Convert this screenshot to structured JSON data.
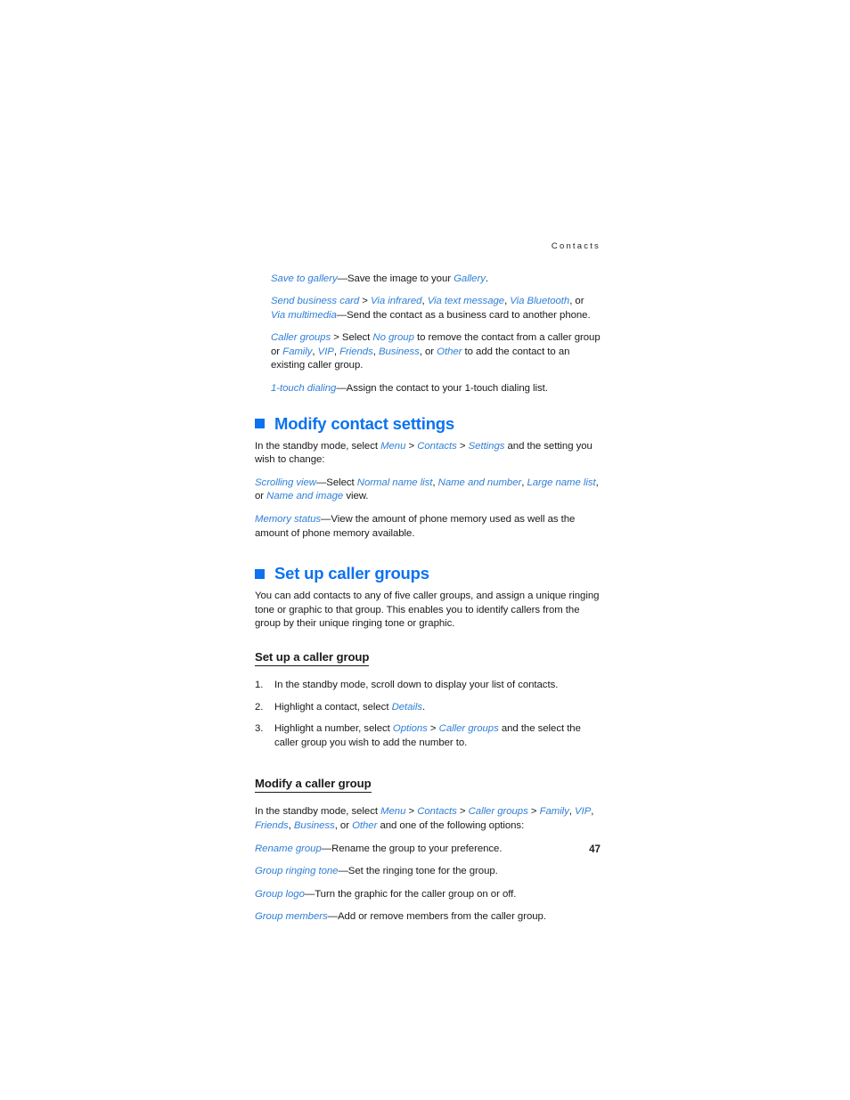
{
  "page": {
    "running_head": "Contacts",
    "page_number": "47",
    "accent_color": "#0c72ef",
    "link_color": "#2f7fd6",
    "text_color": "#1a1a1a"
  },
  "options_block": {
    "items": [
      {
        "id": "save-to-gallery",
        "segments": [
          {
            "t": "Save to gallery",
            "s": "link"
          },
          {
            "t": "—Save the image to your ",
            "s": "plain"
          },
          {
            "t": "Gallery",
            "s": "link"
          },
          {
            "t": ".",
            "s": "plain"
          }
        ]
      },
      {
        "id": "send-business-card",
        "segments": [
          {
            "t": "Send business card",
            "s": "link"
          },
          {
            "t": " > ",
            "s": "plain"
          },
          {
            "t": "Via infrared",
            "s": "link"
          },
          {
            "t": ", ",
            "s": "plain"
          },
          {
            "t": "Via text message",
            "s": "link"
          },
          {
            "t": ", ",
            "s": "plain"
          },
          {
            "t": "Via Bluetooth",
            "s": "link"
          },
          {
            "t": ", or ",
            "s": "plain"
          },
          {
            "t": "Via multimedia",
            "s": "link"
          },
          {
            "t": "—Send the contact as a business card to another phone.",
            "s": "plain"
          }
        ]
      },
      {
        "id": "caller-groups",
        "segments": [
          {
            "t": "Caller groups",
            "s": "link"
          },
          {
            "t": " > Select ",
            "s": "plain"
          },
          {
            "t": "No group",
            "s": "link"
          },
          {
            "t": " to remove the contact from a caller group or ",
            "s": "plain"
          },
          {
            "t": "Family",
            "s": "link"
          },
          {
            "t": ", ",
            "s": "plain"
          },
          {
            "t": "VIP",
            "s": "link"
          },
          {
            "t": ", ",
            "s": "plain"
          },
          {
            "t": "Friends",
            "s": "link"
          },
          {
            "t": ", ",
            "s": "plain"
          },
          {
            "t": "Business",
            "s": "link"
          },
          {
            "t": ", or ",
            "s": "plain"
          },
          {
            "t": "Other",
            "s": "link"
          },
          {
            "t": " to add the contact to an existing caller group.",
            "s": "plain"
          }
        ]
      },
      {
        "id": "one-touch-dialing",
        "segments": [
          {
            "t": "1-touch dialing",
            "s": "link"
          },
          {
            "t": "—Assign the contact to your 1-touch dialing list.",
            "s": "plain"
          }
        ]
      }
    ]
  },
  "section_modify_contact_settings": {
    "heading": "Modify contact settings",
    "paragraphs": [
      {
        "id": "intro",
        "segments": [
          {
            "t": "In the standby mode, select ",
            "s": "plain"
          },
          {
            "t": "Menu",
            "s": "link"
          },
          {
            "t": " > ",
            "s": "plain"
          },
          {
            "t": "Contacts",
            "s": "link"
          },
          {
            "t": " > ",
            "s": "plain"
          },
          {
            "t": "Settings",
            "s": "link"
          },
          {
            "t": " and the setting you wish to change:",
            "s": "plain"
          }
        ]
      },
      {
        "id": "scrolling-view",
        "segments": [
          {
            "t": "Scrolling view",
            "s": "link"
          },
          {
            "t": "—Select ",
            "s": "plain"
          },
          {
            "t": "Normal name list",
            "s": "link"
          },
          {
            "t": ", ",
            "s": "plain"
          },
          {
            "t": "Name and number",
            "s": "link"
          },
          {
            "t": ", ",
            "s": "plain"
          },
          {
            "t": "Large name list",
            "s": "link"
          },
          {
            "t": ", or ",
            "s": "plain"
          },
          {
            "t": "Name and image",
            "s": "link"
          },
          {
            "t": " view.",
            "s": "plain"
          }
        ]
      },
      {
        "id": "memory-status",
        "segments": [
          {
            "t": "Memory status",
            "s": "link"
          },
          {
            "t": "—View the amount of phone memory used as well as the amount of phone memory available.",
            "s": "plain"
          }
        ]
      }
    ]
  },
  "section_set_up_caller_groups": {
    "heading": "Set up caller groups",
    "intro": [
      {
        "id": "intro",
        "segments": [
          {
            "t": "You can add contacts to any of five caller groups, and assign a unique ringing tone or graphic to that group. This enables you to identify callers from the group by their unique ringing tone or graphic.",
            "s": "plain"
          }
        ]
      }
    ],
    "sub_set_up": {
      "heading": "Set up a caller group",
      "steps": [
        {
          "num": "1.",
          "segments": [
            {
              "t": "In the standby mode, scroll down to display your list of contacts.",
              "s": "plain"
            }
          ]
        },
        {
          "num": "2.",
          "segments": [
            {
              "t": "Highlight a contact, select ",
              "s": "plain"
            },
            {
              "t": "Details",
              "s": "link"
            },
            {
              "t": ".",
              "s": "plain"
            }
          ]
        },
        {
          "num": "3.",
          "segments": [
            {
              "t": "Highlight a number, select ",
              "s": "plain"
            },
            {
              "t": "Options",
              "s": "link"
            },
            {
              "t": " > ",
              "s": "plain"
            },
            {
              "t": "Caller groups",
              "s": "link"
            },
            {
              "t": " and the select the caller group you wish to add the number to.",
              "s": "plain"
            }
          ]
        }
      ]
    },
    "sub_modify": {
      "heading": "Modify a caller group",
      "paragraphs": [
        {
          "id": "intro",
          "segments": [
            {
              "t": "In the standby mode, select ",
              "s": "plain"
            },
            {
              "t": "Menu",
              "s": "link"
            },
            {
              "t": " > ",
              "s": "plain"
            },
            {
              "t": "Contacts",
              "s": "link"
            },
            {
              "t": " > ",
              "s": "plain"
            },
            {
              "t": "Caller groups",
              "s": "link"
            },
            {
              "t": " > ",
              "s": "plain"
            },
            {
              "t": "Family",
              "s": "link"
            },
            {
              "t": ", ",
              "s": "plain"
            },
            {
              "t": "VIP",
              "s": "link"
            },
            {
              "t": ", ",
              "s": "plain"
            },
            {
              "t": "Friends",
              "s": "link"
            },
            {
              "t": ", ",
              "s": "plain"
            },
            {
              "t": "Business",
              "s": "link"
            },
            {
              "t": ", or ",
              "s": "plain"
            },
            {
              "t": "Other",
              "s": "link"
            },
            {
              "t": " and one of the following options:",
              "s": "plain"
            }
          ]
        },
        {
          "id": "rename-group",
          "segments": [
            {
              "t": "Rename group",
              "s": "link"
            },
            {
              "t": "—Rename the group to your preference.",
              "s": "plain"
            }
          ]
        },
        {
          "id": "group-ringing-tone",
          "segments": [
            {
              "t": "Group ringing tone",
              "s": "link"
            },
            {
              "t": "—Set the ringing tone for the group.",
              "s": "plain"
            }
          ]
        },
        {
          "id": "group-logo",
          "segments": [
            {
              "t": "Group logo",
              "s": "link"
            },
            {
              "t": "—Turn the graphic for the caller group on or off.",
              "s": "plain"
            }
          ]
        },
        {
          "id": "group-members",
          "segments": [
            {
              "t": "Group members",
              "s": "link"
            },
            {
              "t": "—Add or remove members from the caller group.",
              "s": "plain"
            }
          ]
        }
      ]
    }
  }
}
